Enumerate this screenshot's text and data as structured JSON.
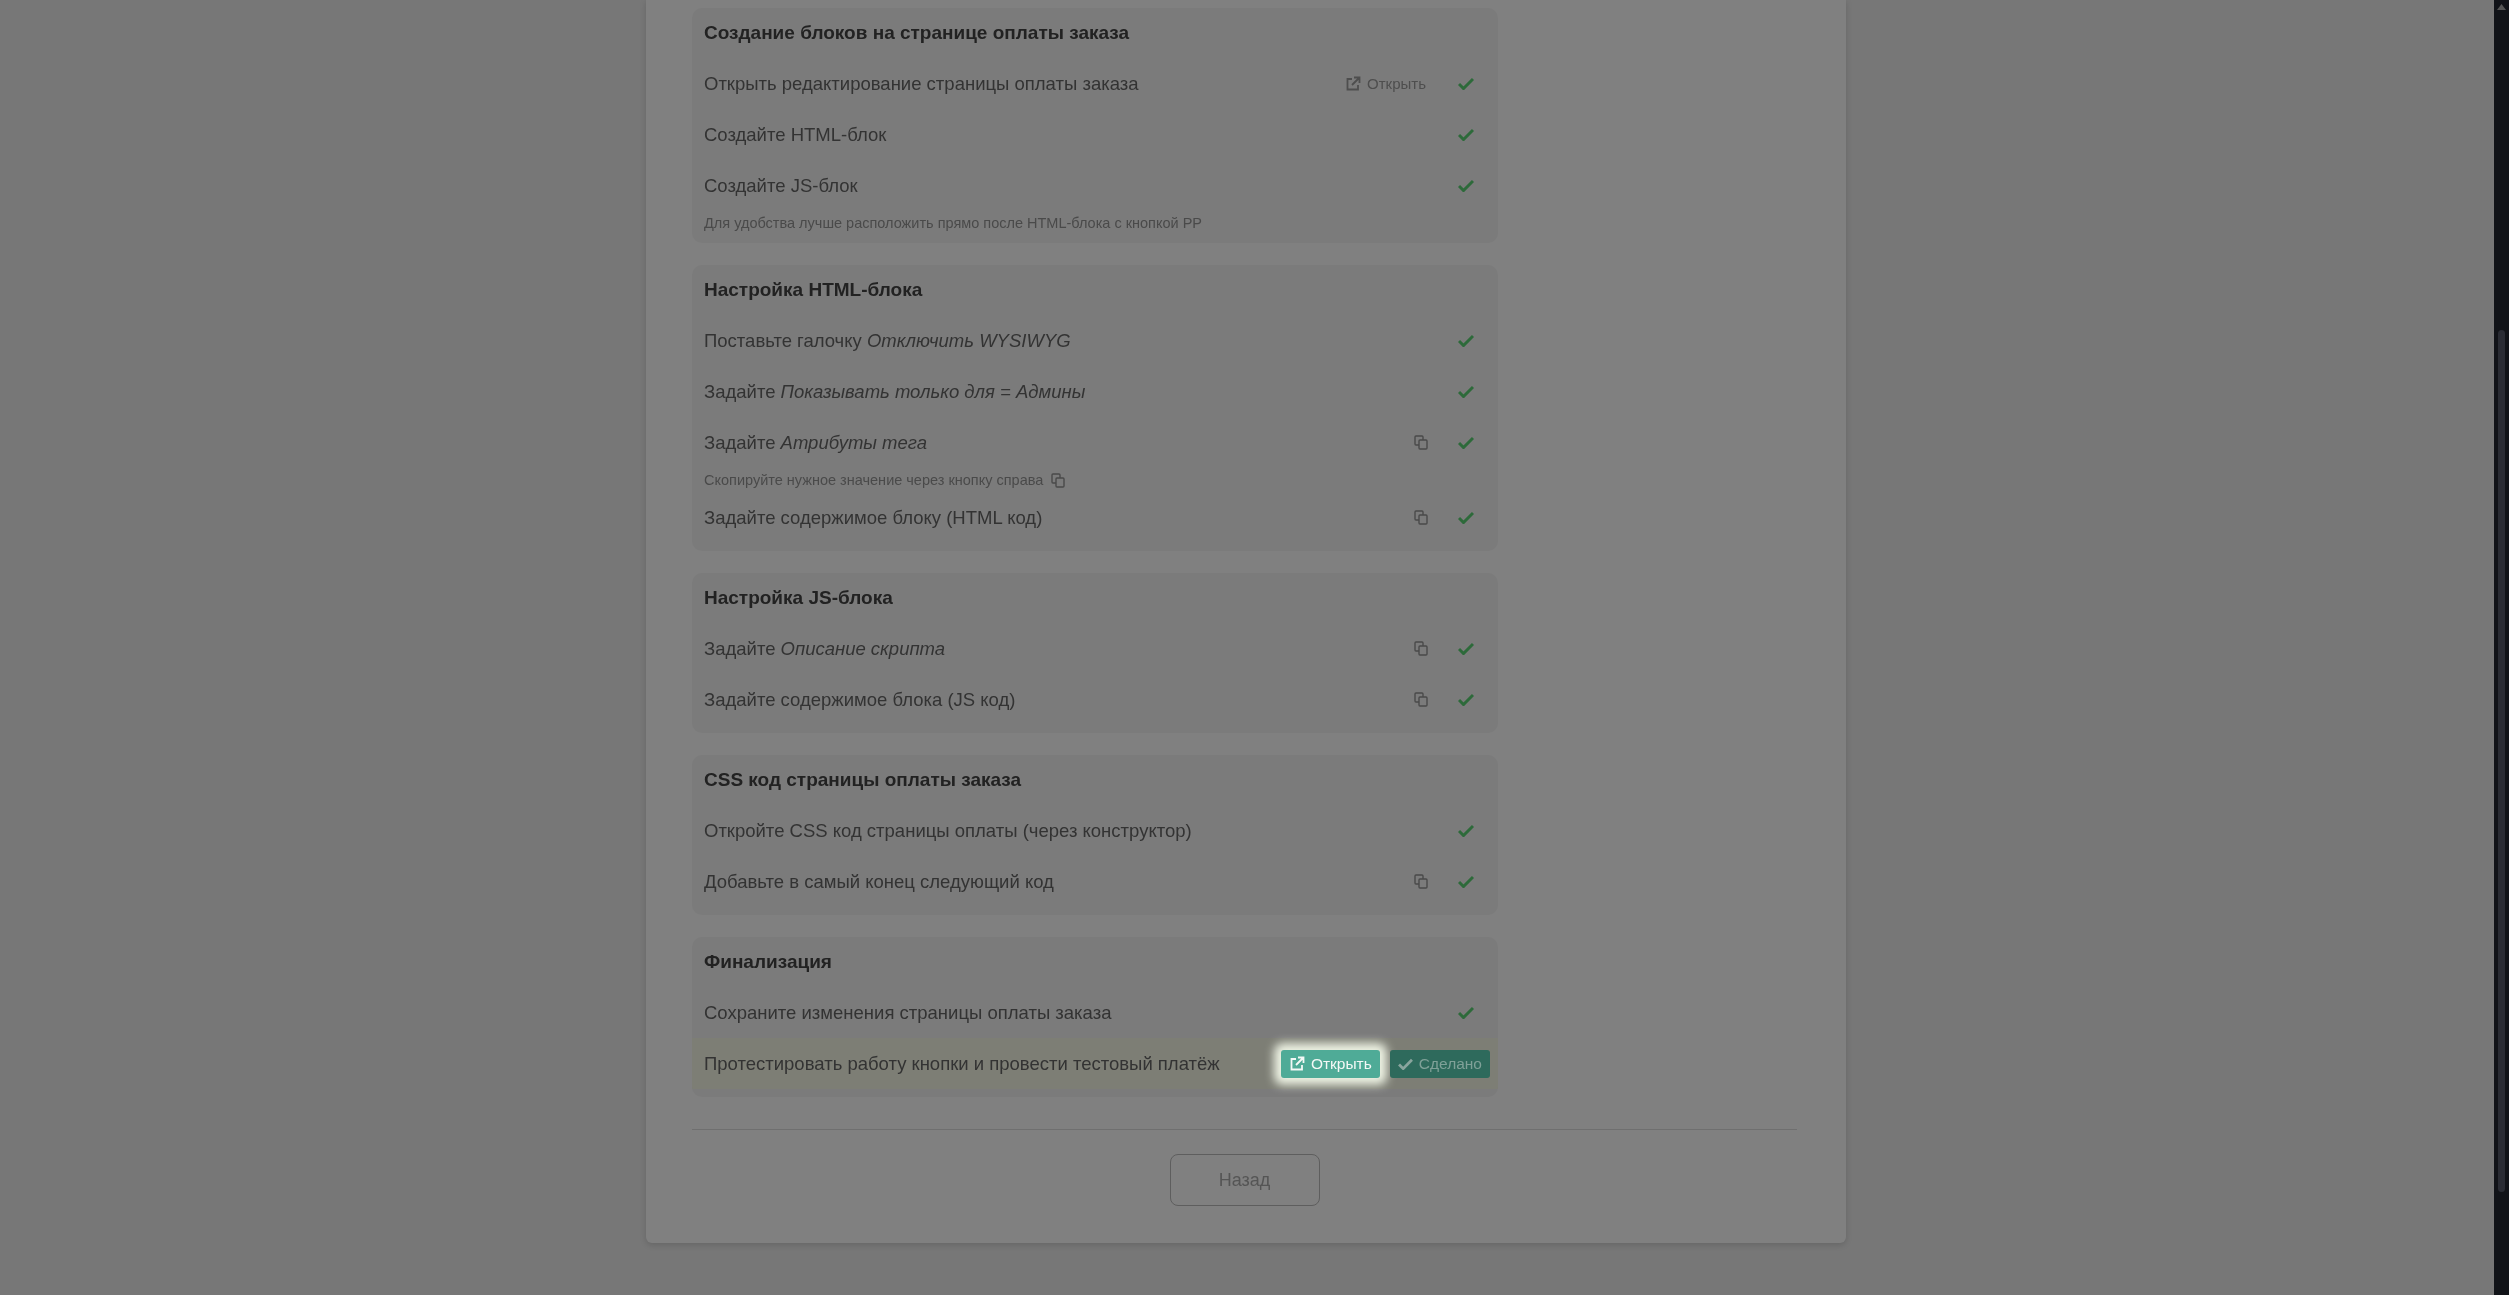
{
  "sections": [
    {
      "title": "Создание блоков на странице оплаты заказа",
      "items": [
        {
          "text": "Открыть редактирование страницы оплаты заказа",
          "link": "Открыть",
          "copy": false,
          "done": true
        },
        {
          "text": "Создайте HTML-блок",
          "copy": false,
          "done": true
        },
        {
          "text": "Создайте JS-блок",
          "hint": "Для удобства лучше расположить прямо после HTML-блока с кнопкой PP",
          "hint_copy": false,
          "copy": false,
          "done": true
        }
      ]
    },
    {
      "title": "Настройка HTML-блока",
      "items": [
        {
          "text": "Поставьте галочку *Отключить WYSIWYG*",
          "copy": false,
          "done": true
        },
        {
          "text": "Задайте *Показывать только для = Админы*",
          "copy": false,
          "done": true
        },
        {
          "text": "Задайте *Атрибуты тега*",
          "hint": "Скопируйте нужное значение через кнопку справа",
          "hint_copy": true,
          "copy": true,
          "done": true
        },
        {
          "text": "Задайте содержимое блоку (HTML код)",
          "copy": true,
          "done": true
        }
      ]
    },
    {
      "title": "Настройка JS-блока",
      "items": [
        {
          "text": "Задайте *Описание скрипта*",
          "copy": true,
          "done": true
        },
        {
          "text": "Задайте содержимое блока (JS код)",
          "copy": true,
          "done": true
        }
      ]
    },
    {
      "title": "CSS код страницы оплаты заказа",
      "items": [
        {
          "text": "Откройте CSS код страницы оплаты (через конструктор)",
          "copy": false,
          "done": true
        },
        {
          "text": "Добавьте в самый конец следующий код",
          "copy": true,
          "done": true
        }
      ]
    },
    {
      "title": "Финализация",
      "items": [
        {
          "text": "Сохраните изменения страницы оплаты заказа",
          "copy": false,
          "done": true
        },
        {
          "text": "Протестировать работу кнопки и провести тестовый платёж",
          "copy": false,
          "done": false,
          "actions": [
            {
              "kind": "open",
              "label": "Открыть",
              "highlighted": true
            },
            {
              "kind": "done",
              "label": "Сделано",
              "highlighted": false
            }
          ]
        }
      ]
    }
  ],
  "back_button": "Назад"
}
